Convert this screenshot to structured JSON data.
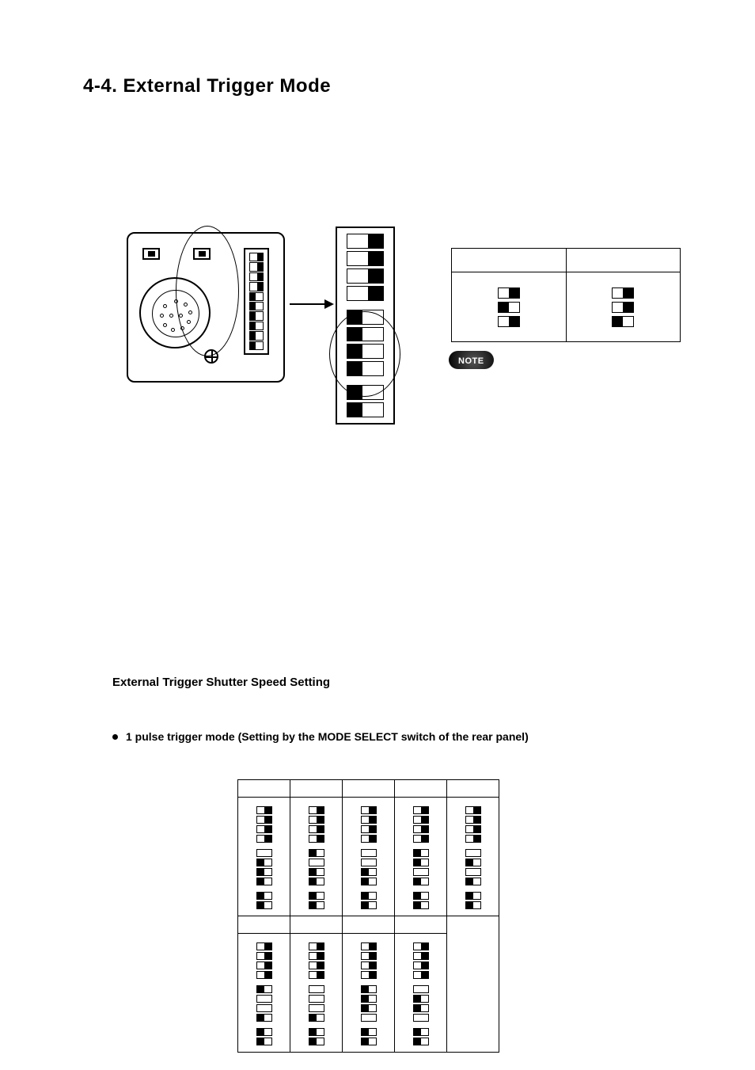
{
  "heading": "4-4. External Trigger Mode",
  "device_mini_dip": [
    "r",
    "r",
    "r",
    "r",
    "l",
    "l",
    "l",
    "l",
    "l",
    "l"
  ],
  "big_dip": [
    "r",
    "r",
    "r",
    "r",
    "l",
    "l",
    "l",
    "l",
    "l",
    "l"
  ],
  "mode_table": {
    "col_a": {
      "switches": [
        "r",
        "l",
        "r"
      ]
    },
    "col_b": {
      "switches": [
        "r",
        "r",
        "l"
      ]
    }
  },
  "note_label": "NOTE",
  "subheading": "External Trigger Shutter Speed Setting",
  "bullet_text": "1 pulse trigger mode (Setting by the MODE SELECT switch of the rear panel)",
  "speed_table": {
    "row1": [
      {
        "switches": [
          "r",
          "r",
          "r",
          "r",
          "blank",
          "l",
          "l",
          "l",
          "l",
          "l"
        ]
      },
      {
        "switches": [
          "r",
          "r",
          "r",
          "r",
          "l",
          "blank",
          "l",
          "l",
          "l",
          "l"
        ]
      },
      {
        "switches": [
          "r",
          "r",
          "r",
          "r",
          "blank",
          "blank",
          "l",
          "l",
          "l",
          "l"
        ]
      },
      {
        "switches": [
          "r",
          "r",
          "r",
          "r",
          "l",
          "l",
          "blank",
          "l",
          "l",
          "l"
        ]
      },
      {
        "switches": [
          "r",
          "r",
          "r",
          "r",
          "blank",
          "l",
          "blank",
          "l",
          "l",
          "l"
        ]
      }
    ],
    "row2": [
      {
        "switches": [
          "r",
          "r",
          "r",
          "r",
          "l",
          "blank",
          "blank",
          "l",
          "l",
          "l"
        ]
      },
      {
        "switches": [
          "r",
          "r",
          "r",
          "r",
          "blank",
          "blank",
          "blank",
          "l",
          "l",
          "l"
        ]
      },
      {
        "switches": [
          "r",
          "r",
          "r",
          "r",
          "l",
          "l",
          "l",
          "blank",
          "l",
          "l"
        ]
      },
      {
        "switches": [
          "r",
          "r",
          "r",
          "r",
          "blank",
          "l",
          "l",
          "blank",
          "l",
          "l"
        ]
      },
      null
    ]
  }
}
